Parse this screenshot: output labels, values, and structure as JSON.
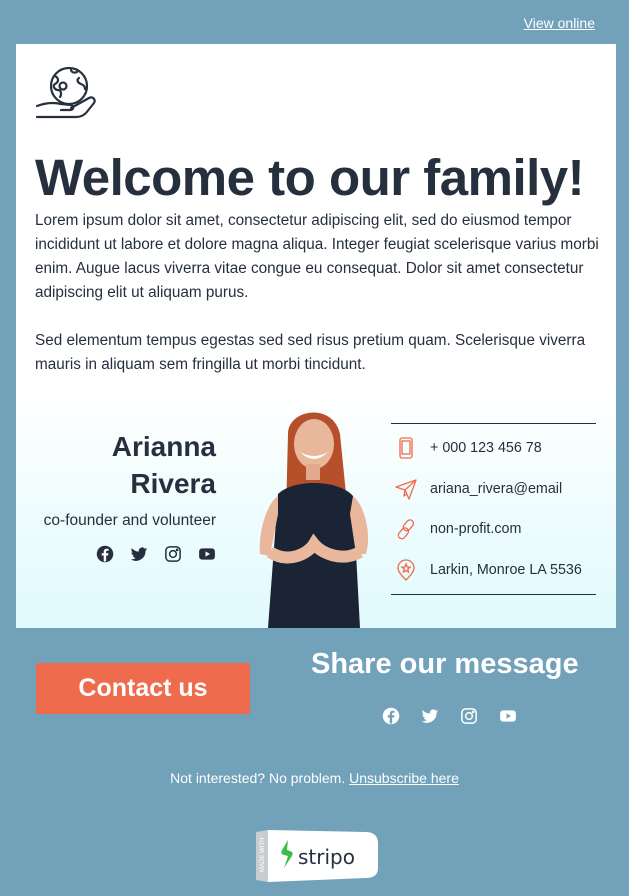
{
  "header": {
    "view_online": "View online"
  },
  "hero": {
    "logo_icon": "globe-in-hand-icon",
    "title": "Welcome to our family!",
    "paragraph_1": "Lorem ipsum dolor sit amet, consectetur adipiscing elit, sed do eiusmod tempor incididunt ut labore et dolore magna aliqua. Integer feugiat scelerisque varius morbi enim. Augue lacus viverra vitae congue eu consequat. Dolor sit amet consectetur adipiscing elit ut aliquam purus.",
    "paragraph_2": "Sed elementum tempus egestas sed sed risus pretium quam. Scelerisque viverra mauris in aliquam sem fringilla ut morbi tincidunt."
  },
  "profile": {
    "first_name": "Arianna",
    "last_name": "Rivera",
    "role": "co-founder and volunteer",
    "socials": [
      "facebook-icon",
      "twitter-icon",
      "instagram-icon",
      "youtube-icon"
    ],
    "contacts": [
      {
        "icon": "phone-icon",
        "text": "+ 000 123 456 78"
      },
      {
        "icon": "paper-plane-icon",
        "text": "ariana_rivera@email"
      },
      {
        "icon": "link-icon",
        "text": "non-profit.com"
      },
      {
        "icon": "location-pin-icon",
        "text": "Larkin, Monroe LA 5536"
      }
    ]
  },
  "footer": {
    "cta_label": "Contact us",
    "share_title": "Share our message",
    "unsub_text": "Not interested? No problem. ",
    "unsub_link": "Unsubscribe here",
    "badge_made_with": "MADE WITH",
    "badge_brand": "stripo"
  },
  "colors": {
    "background": "#71a2ba",
    "accent": "#ef6b4e",
    "text_dark": "#262f3e",
    "profile_gradient_end": "#e0fafd"
  }
}
